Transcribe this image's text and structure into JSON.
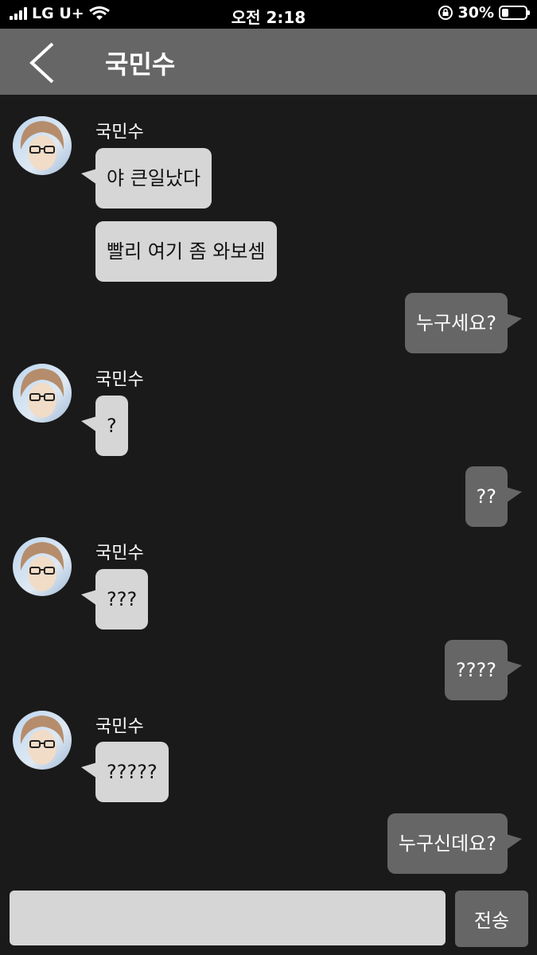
{
  "status": {
    "carrier": "LG U+",
    "time": "오전 2:18",
    "battery": "30%",
    "battery_level": 0.3
  },
  "header": {
    "title": "국민수",
    "back_icon": "chevron-left-icon"
  },
  "messages": [
    {
      "sender": "국민수",
      "text": "야 큰일났다"
    },
    {
      "text": "빨리 여기 좀 와보셈"
    },
    {
      "from_me": true,
      "text": "누구세요?"
    },
    {
      "sender": "국민수",
      "text": "?"
    },
    {
      "from_me": true,
      "text": "??"
    },
    {
      "sender": "국민수",
      "text": "???"
    },
    {
      "from_me": true,
      "text": "????"
    },
    {
      "sender": "국민수",
      "text": "?????"
    },
    {
      "from_me": true,
      "text": "누구신데요?"
    }
  ],
  "composer": {
    "input_value": "",
    "send_label": "전송"
  },
  "colors": {
    "background": "#1a1a1a",
    "header": "#666666",
    "incoming_bubble": "#d6d6d6",
    "outgoing_bubble": "#666666"
  }
}
